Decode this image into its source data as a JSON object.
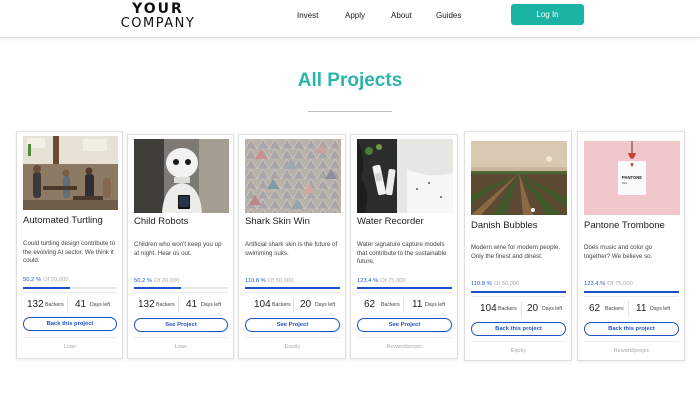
{
  "header": {
    "logo_line1": "YOUR",
    "logo_line2": "COMPANY",
    "nav": [
      "Invest",
      "Apply",
      "About",
      "Guides"
    ],
    "login_label": "Log In"
  },
  "main": {
    "title": "All Projects"
  },
  "projects": [
    {
      "title": "Automated Turtling",
      "description": "Could turtling design contribute to the evolving AI sector. We think it could.",
      "funded_pct": "50.2 %",
      "goal": "Of 20,000",
      "progress": 0.502,
      "backers": "132",
      "backers_label": "Backers",
      "days": "41",
      "days_label": "Days left",
      "button": "Back this project",
      "type": "Loan",
      "image": "cafe-photo"
    },
    {
      "title": "Child Robots",
      "description": "Children who won't keep you up at night. Hear us out.",
      "funded_pct": "50.2 %",
      "goal": "Of 20,000",
      "progress": 0.502,
      "backers": "132",
      "backers_label": "Backers",
      "days": "41",
      "days_label": "Days left",
      "button": "See Project",
      "type": "Loan",
      "image": "robot-photo"
    },
    {
      "title": "Shark Skin Win",
      "description": "Artificial shark skin is the future of swimming suits.",
      "funded_pct": "110.8 %",
      "goal": "Of 50,000",
      "progress": 1,
      "backers": "104",
      "backers_label": "Backers",
      "days": "20",
      "days_label": "Days left",
      "button": "See Project",
      "type": "Equity",
      "image": "tiles-photo"
    },
    {
      "title": "Water Recorder",
      "description": "Water signature capture models that contribute to the sustainable future.",
      "funded_pct": "123.4 %",
      "goal": "Of 75,000",
      "progress": 1,
      "backers": "62",
      "backers_label": "Backers",
      "days": "11",
      "days_label": "Days left",
      "button": "See Project",
      "type": "Reward/projec",
      "image": "bottle-photo"
    },
    {
      "title": "Danish Bubbles",
      "description": "Modern wine for modern people. Only the finest and dinest.",
      "funded_pct": "110.8 %",
      "goal": "Of 50,000",
      "progress": 1,
      "backers": "104",
      "backers_label": "Backers",
      "days": "20",
      "days_label": "Days left",
      "button": "Back this project",
      "type": "Equity",
      "image": "vineyard-photo"
    },
    {
      "title": "Pantone Trombone",
      "description": "Does music and color go together? We believe so.",
      "funded_pct": "123.4 %",
      "goal": "Of 75,000",
      "progress": 1,
      "backers": "62",
      "backers_label": "Backers",
      "days": "11",
      "days_label": "Days left",
      "button": "Back this project",
      "type": "Reward/projec",
      "image": "pantone-photo"
    }
  ]
}
